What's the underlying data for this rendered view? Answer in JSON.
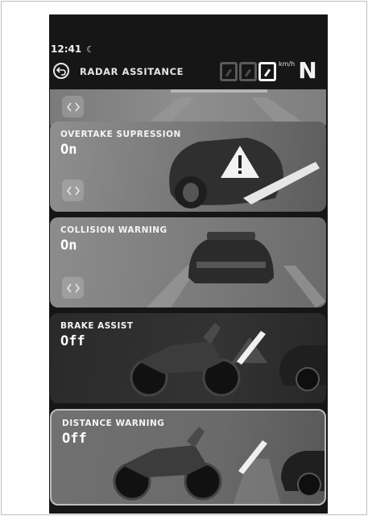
{
  "status_bar": {
    "time": "12:41",
    "night_icon": "moon-icon"
  },
  "header": {
    "back_icon": "back-arrow-icon",
    "title": "RADAR ASSITANCE",
    "speed_unit": "km/h",
    "gear": "N"
  },
  "cards": [
    {
      "label": "OVERTAKE SUPRESSION",
      "value": "On"
    },
    {
      "label": "COLLISION WARNING",
      "value": "On"
    },
    {
      "label": "BRAKE ASSIST",
      "value": "Off"
    },
    {
      "label": "DISTANCE WARNING",
      "value": "Off"
    }
  ],
  "toggle_icon": "left-right-chevrons-icon",
  "warning_icon": "warning-triangle-icon"
}
